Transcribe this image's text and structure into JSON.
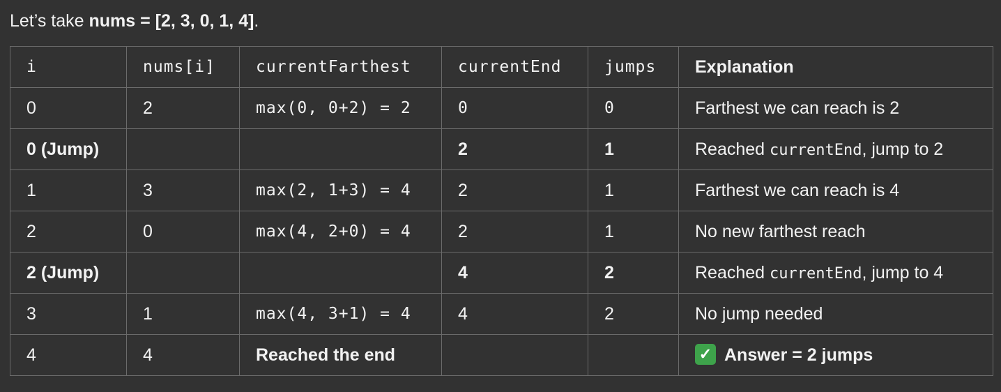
{
  "intro": {
    "prefix": "Let’s take ",
    "bold": "nums = [2, 3, 0, 1, 4]",
    "suffix": "."
  },
  "table": {
    "headers": {
      "i": "i",
      "nums_i": "nums[i]",
      "current_farthest": "currentFarthest",
      "current_end": "currentEnd",
      "jumps": "jumps",
      "explanation": "Explanation"
    },
    "rows": [
      {
        "i": "0",
        "nums_i": "2",
        "current_farthest": "max(0, 0+2) = 2",
        "current_end": "0",
        "jumps": "0",
        "explanation": "Farthest we can reach is 2"
      },
      {
        "i": "0 (Jump)",
        "nums_i": "",
        "current_farthest": "",
        "current_end": "2",
        "jumps": "1",
        "explanation_pre": "Reached ",
        "explanation_code": "currentEnd",
        "explanation_post": ", jump to 2"
      },
      {
        "i": "1",
        "nums_i": "3",
        "current_farthest": "max(2, 1+3) = 4",
        "current_end": "2",
        "jumps": "1",
        "explanation": "Farthest we can reach is 4"
      },
      {
        "i": "2",
        "nums_i": "0",
        "current_farthest": "max(4, 2+0) = 4",
        "current_end": "2",
        "jumps": "1",
        "explanation": "No new farthest reach"
      },
      {
        "i": "2 (Jump)",
        "nums_i": "",
        "current_farthest": "",
        "current_end": "4",
        "jumps": "2",
        "explanation_pre": "Reached ",
        "explanation_code": "currentEnd",
        "explanation_post": ", jump to 4"
      },
      {
        "i": "3",
        "nums_i": "1",
        "current_farthest": "max(4, 3+1) = 4",
        "current_end": "4",
        "jumps": "2",
        "explanation": "No jump needed"
      },
      {
        "i": "4",
        "nums_i": "4",
        "current_farthest": "Reached the end",
        "current_end": "",
        "jumps": "",
        "explanation_icon": "check-mark-icon",
        "explanation_icon_glyph": "✓",
        "explanation": "Answer = 2 jumps"
      }
    ]
  },
  "colors": {
    "background": "#323232",
    "border": "#6b6b6b",
    "text": "#f2f2f2",
    "check_bg": "#3ea34b"
  }
}
